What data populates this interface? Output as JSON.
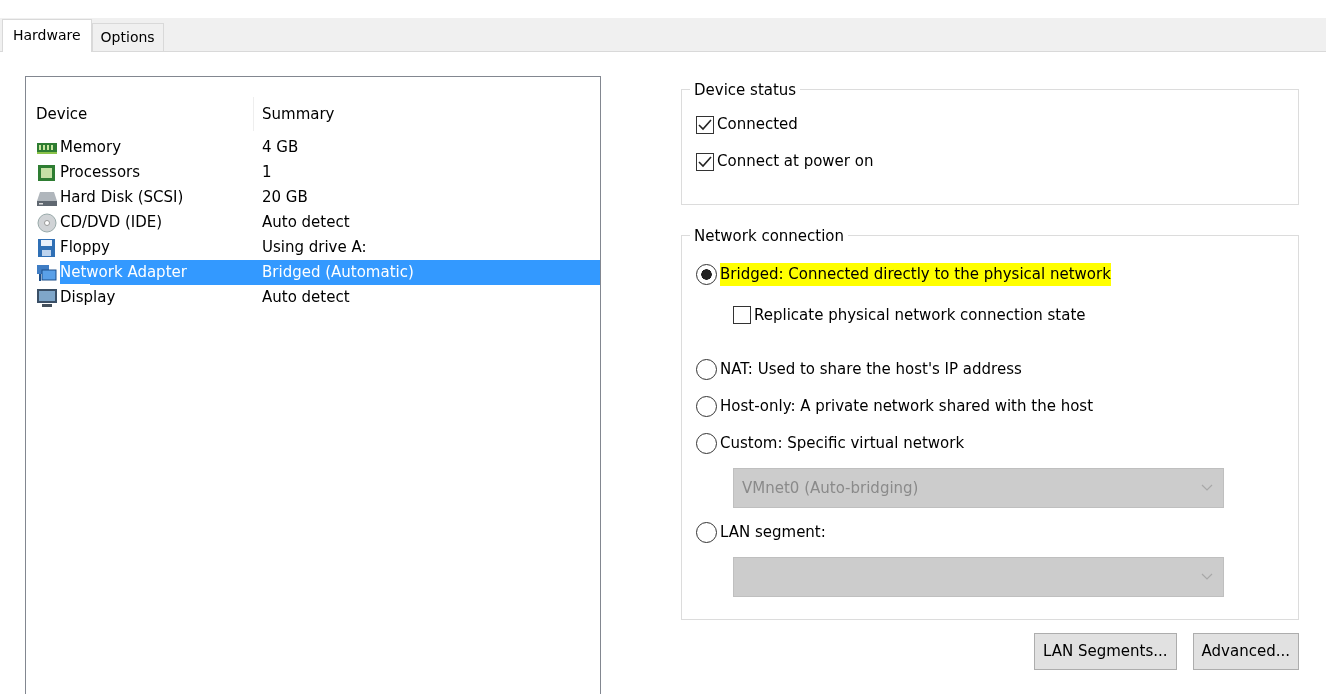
{
  "tabs": [
    {
      "label": "Hardware",
      "selected": true
    },
    {
      "label": "Options",
      "selected": false
    }
  ],
  "device_list": {
    "columns": [
      "Device",
      "Summary"
    ],
    "rows": [
      {
        "kind": "memory",
        "device": "Memory",
        "summary": "4 GB",
        "selected": false
      },
      {
        "kind": "processor",
        "device": "Processors",
        "summary": "1",
        "selected": false
      },
      {
        "kind": "disk",
        "device": "Hard Disk (SCSI)",
        "summary": "20 GB",
        "selected": false
      },
      {
        "kind": "cd",
        "device": "CD/DVD (IDE)",
        "summary": "Auto detect",
        "selected": false
      },
      {
        "kind": "floppy",
        "device": "Floppy",
        "summary": "Using drive A:",
        "selected": false
      },
      {
        "kind": "network",
        "device": "Network Adapter",
        "summary": "Bridged (Automatic)",
        "selected": true
      },
      {
        "kind": "display",
        "device": "Display",
        "summary": "Auto detect",
        "selected": false
      }
    ]
  },
  "device_status": {
    "title": "Device status",
    "options": [
      {
        "label": "Connected",
        "checked": true
      },
      {
        "label": "Connect at power on",
        "checked": true
      }
    ]
  },
  "network_connection": {
    "title": "Network connection",
    "options": [
      {
        "label": "Bridged: Connected directly to the physical network",
        "selected": true,
        "highlighted": true,
        "sub": {
          "kind": "checkbox",
          "label": "Replicate physical network connection state",
          "checked": false
        }
      },
      {
        "label": "NAT: Used to share the host's IP address",
        "selected": false,
        "highlighted": false
      },
      {
        "label": "Host-only: A private network shared with the host",
        "selected": false,
        "highlighted": false
      },
      {
        "label": "Custom: Specific virtual network",
        "selected": false,
        "highlighted": false,
        "sub": {
          "kind": "dropdown",
          "value": "VMnet0 (Auto-bridging)",
          "disabled": true
        }
      },
      {
        "label": "LAN segment:",
        "selected": false,
        "highlighted": false,
        "sub": {
          "kind": "dropdown",
          "disabled": true
        }
      }
    ]
  },
  "buttons": [
    "LAN Segments...",
    "Advanced..."
  ]
}
